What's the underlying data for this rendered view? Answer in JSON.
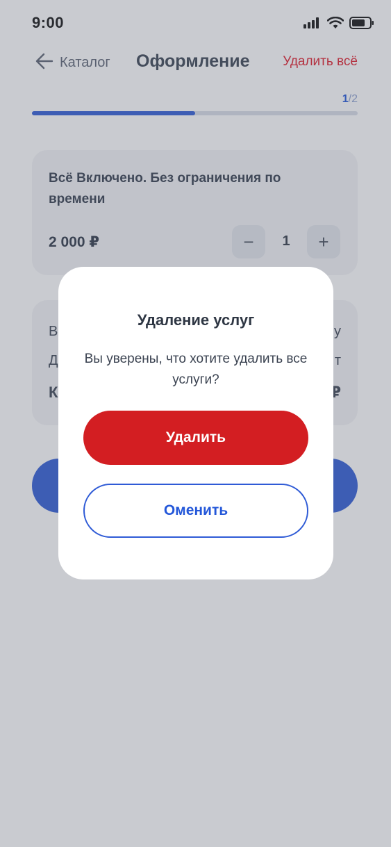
{
  "status_bar": {
    "time": "9:00",
    "icons": [
      "signal-icon",
      "wifi-icon",
      "battery-icon"
    ]
  },
  "header": {
    "back_label": "Каталог",
    "title": "Оформление",
    "delete_all_label": "Удалить всё"
  },
  "progress": {
    "current": "1",
    "separator": "/",
    "total": "2",
    "fraction": 0.5
  },
  "cart_item": {
    "title": "Всё Включено. Без ограничения по времени",
    "price": "2 000 ₽",
    "quantity": "1",
    "minus_label": "−",
    "plus_label": "+"
  },
  "summary_card_fragments": {
    "left_row1": "В",
    "left_row2": "Д",
    "left_row3": "К",
    "right_row1": "у",
    "right_row2": "т",
    "right_row3": "₽"
  },
  "modal": {
    "title": "Удаление услуг",
    "message": "Вы уверены, что хотите удалить все услуги?",
    "confirm_label": "Удалить",
    "cancel_label": "Оменить"
  },
  "colors": {
    "accent_blue": "#2f5bd6",
    "danger_red": "#d31e22",
    "delete_all_red": "#e01c2a"
  }
}
